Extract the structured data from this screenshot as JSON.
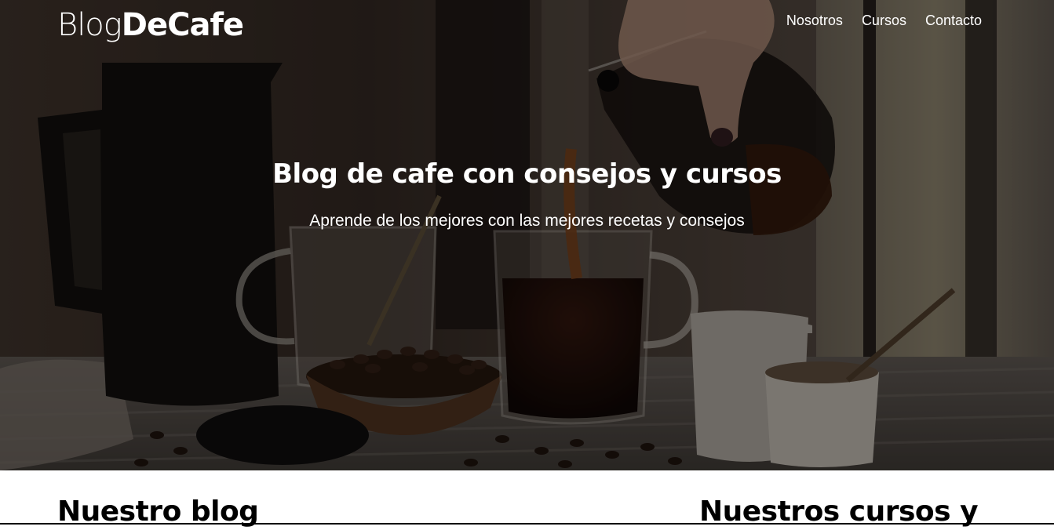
{
  "header": {
    "logo_light": "Blog",
    "logo_bold": "DeCafe",
    "nav": [
      {
        "label": "Nosotros"
      },
      {
        "label": "Cursos"
      },
      {
        "label": "Contacto"
      }
    ]
  },
  "hero": {
    "title": "Blog de cafe con consejos y cursos",
    "subtitle": "Aprende de los mejores con las mejores recetas y consejos",
    "overlay_color": "#000000"
  },
  "sections": {
    "blog_heading": "Nuestro blog",
    "courses_heading": "Nuestros cursos y"
  }
}
